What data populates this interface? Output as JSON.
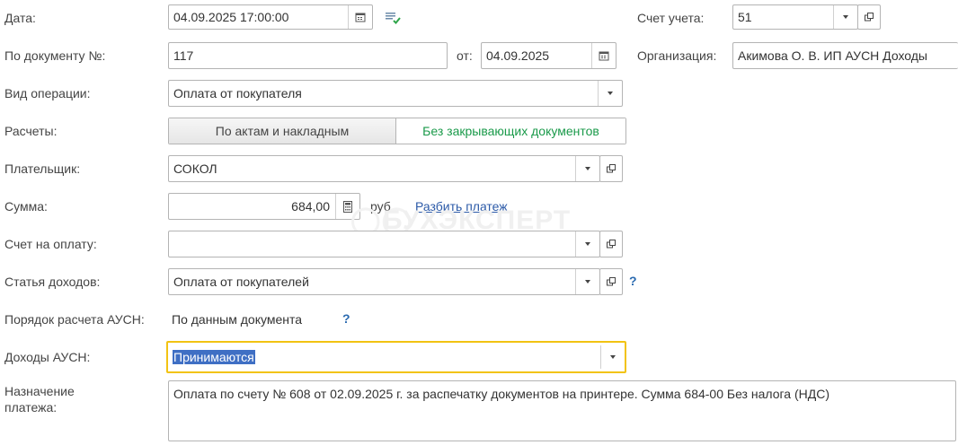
{
  "form": {
    "date": {
      "label": "Дата:",
      "value": "04.09.2025 17:00:00"
    },
    "account": {
      "label": "Счет учета:",
      "value": "51"
    },
    "doc_number": {
      "label": "По документу №:",
      "value": "117"
    },
    "doc_date": {
      "label": "от:",
      "value": "04.09.2025"
    },
    "organization": {
      "label": "Организация:",
      "value": "Акимова О. В. ИП АУСН Доходы"
    },
    "operation_type": {
      "label": "Вид операции:",
      "value": "Оплата от покупателя"
    },
    "settlements": {
      "label": "Расчеты:",
      "option_1": "По актам и накладным",
      "option_2": "Без закрывающих документов"
    },
    "payer": {
      "label": "Плательщик:",
      "value": "СОКОЛ"
    },
    "amount": {
      "label": "Сумма:",
      "value": "684,00",
      "currency": "руб.",
      "split_link": "Разбить платеж"
    },
    "invoice": {
      "label": "Счет на оплату:",
      "value": ""
    },
    "income_item": {
      "label": "Статья доходов:",
      "value": "Оплата от покупателей",
      "help": "?"
    },
    "ausn_order": {
      "label": "Порядок расчета АУСН:",
      "value": "По данным документа",
      "help": "?"
    },
    "ausn_income": {
      "label": "Доходы АУСН:",
      "value": "Принимаются"
    },
    "purpose": {
      "label_line1": "Назначение",
      "label_line2": "платежа:",
      "value": "Оплата по счету № 608 от 02.09.2025 г. за распечатку документов на принтере. Сумма 684-00 Без налога (НДС)"
    }
  },
  "watermark": "БУХЭКСПЕРТ",
  "colors": {
    "accent_green": "#1a9a4a",
    "focus_yellow": "#f2c313",
    "selection": "#3f6fc4",
    "link": "#2c5aa8",
    "help": "#2a6ab0"
  },
  "icons": [
    "calendar-icon",
    "post-document-icon",
    "calculator-icon",
    "open-icon",
    "dropdown-arrow-icon"
  ]
}
